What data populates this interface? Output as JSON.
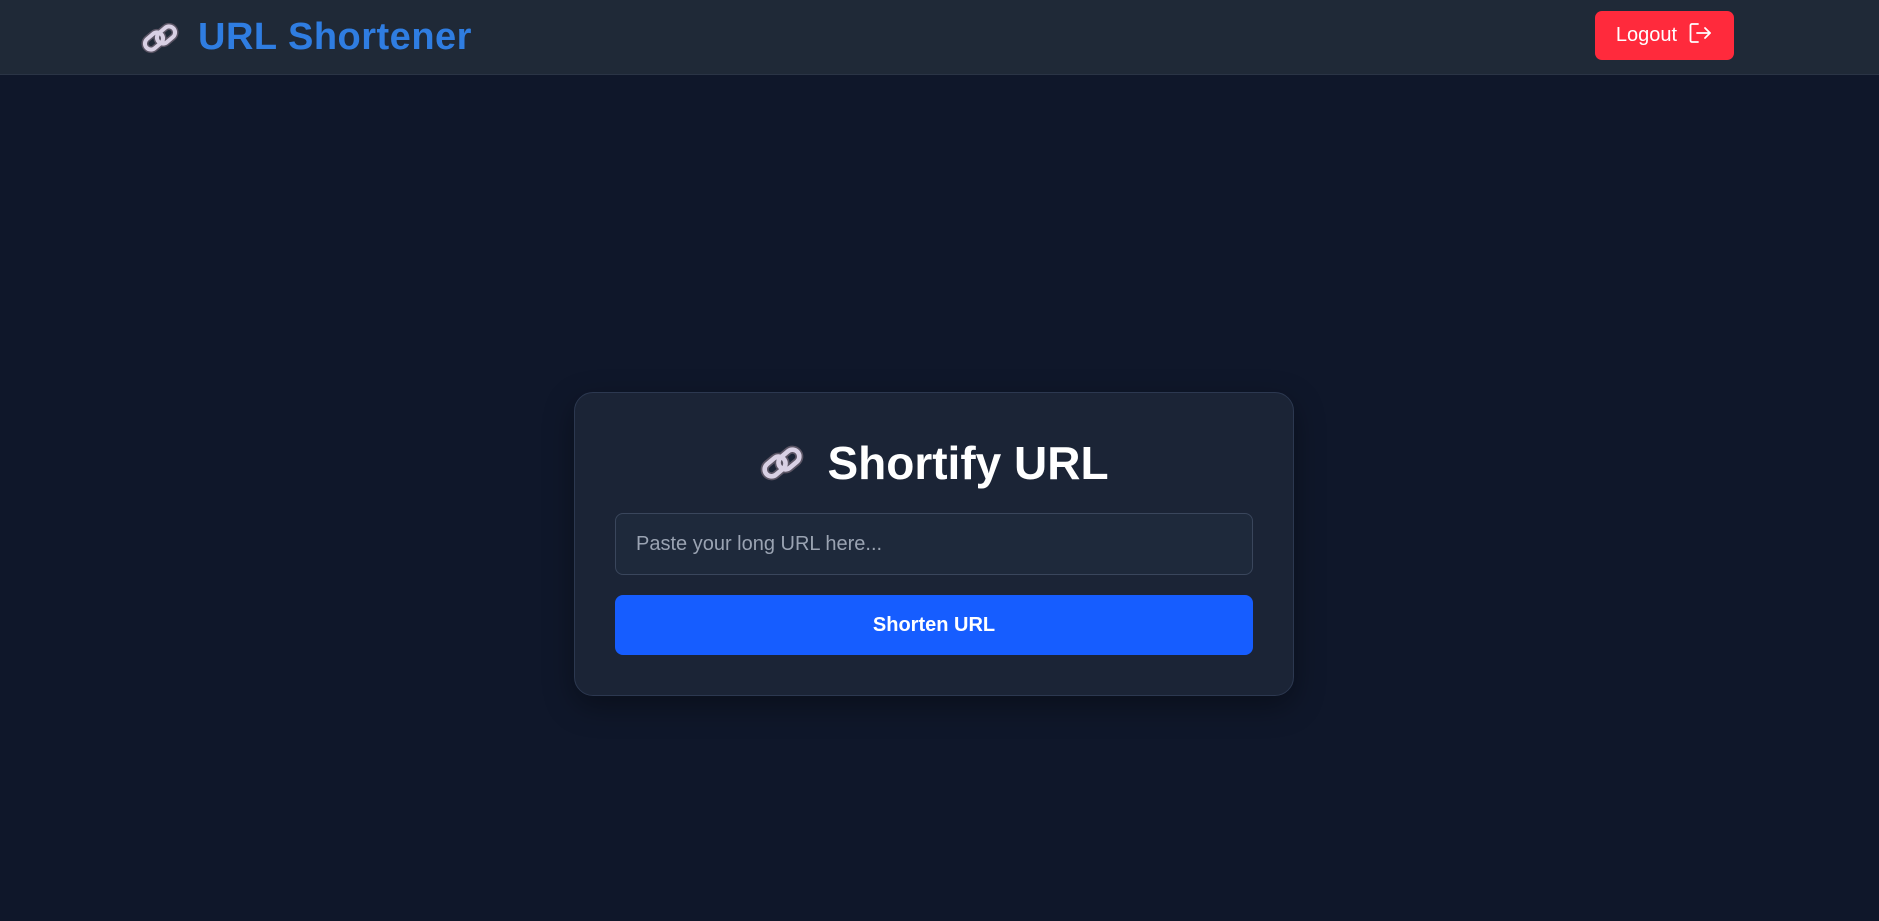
{
  "colors": {
    "background": "#0f172a",
    "navbar": "#1f2937",
    "brand_accent": "#2f7de1",
    "logout": "#ff2a3c",
    "primary_button": "#165dff",
    "card": "#1b2436"
  },
  "header": {
    "brand_icon": "link-icon",
    "title": "URL Shortener",
    "logout_label": "Logout",
    "logout_icon": "logout-icon"
  },
  "card": {
    "icon": "link-icon",
    "title": "Shortify URL",
    "input_placeholder": "Paste your long URL here...",
    "input_value": "",
    "button_label": "Shorten URL"
  }
}
